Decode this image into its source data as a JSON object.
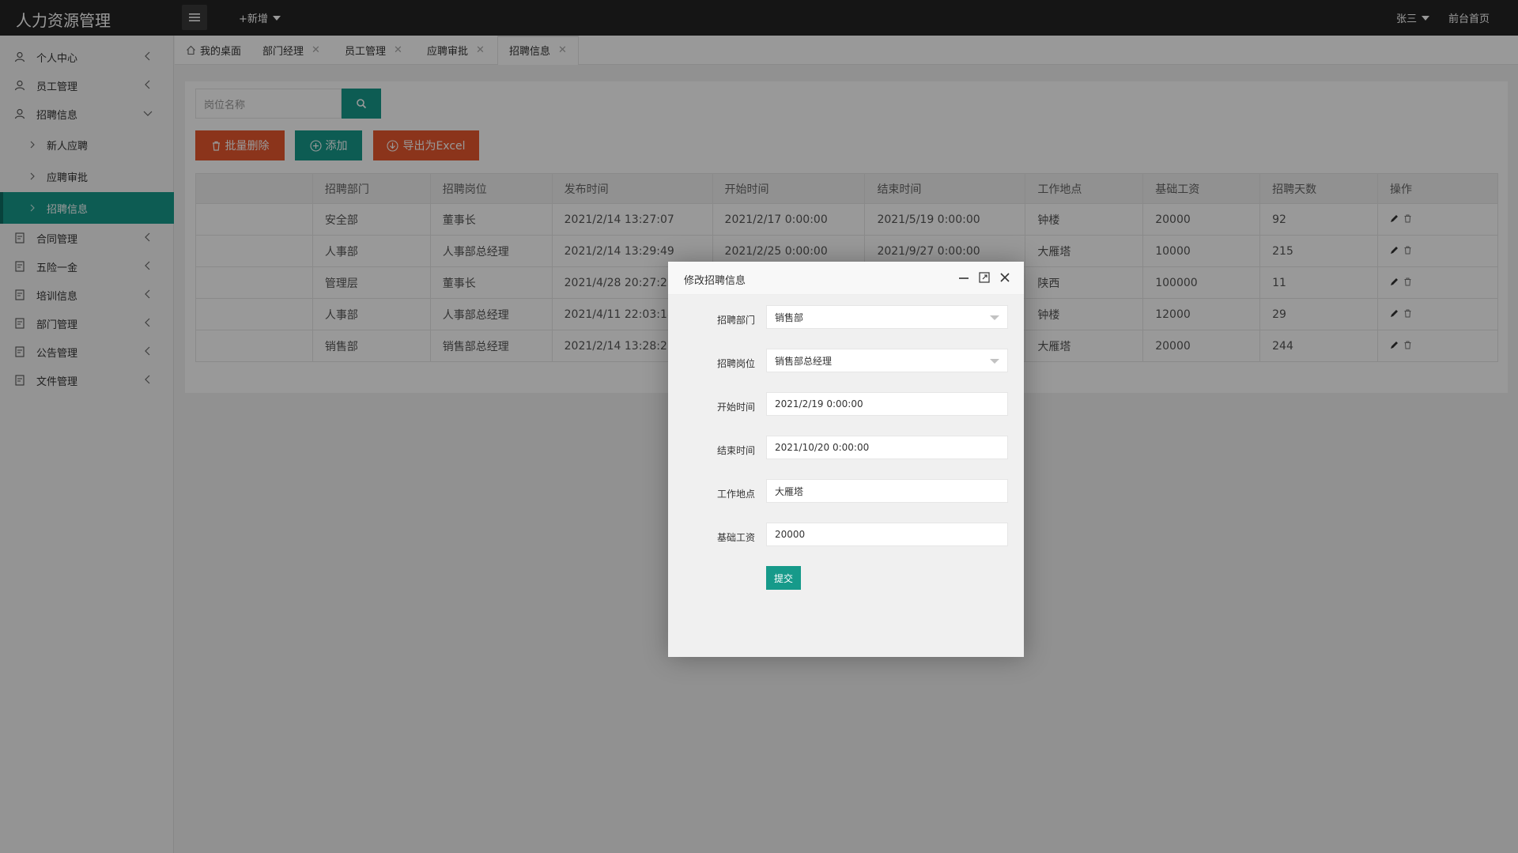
{
  "app": {
    "title": "人力资源管理",
    "new_label": "+新增",
    "user_name": "张三",
    "front_link": "前台首页"
  },
  "sidebar": {
    "items": [
      {
        "label": "个人中心"
      },
      {
        "label": "员工管理"
      },
      {
        "label": "招聘信息",
        "expanded": true
      },
      {
        "label": "合同管理"
      },
      {
        "label": "五险一金"
      },
      {
        "label": "培训信息"
      },
      {
        "label": "部门管理"
      },
      {
        "label": "公告管理"
      },
      {
        "label": "文件管理"
      }
    ],
    "subitems": [
      {
        "label": "新人应聘"
      },
      {
        "label": "应聘审批"
      },
      {
        "label": "招聘信息",
        "active": true
      }
    ]
  },
  "tabs": [
    {
      "label": "我的桌面"
    },
    {
      "label": "部门经理"
    },
    {
      "label": "员工管理"
    },
    {
      "label": "应聘审批"
    },
    {
      "label": "招聘信息",
      "active": true
    }
  ],
  "search": {
    "placeholder": "岗位名称"
  },
  "toolbar": {
    "batch_delete": "批量删除",
    "add": "添加",
    "export": "导出为Excel"
  },
  "table": {
    "headers": [
      "",
      "招聘部门",
      "招聘岗位",
      "发布时间",
      "开始时间",
      "结束时间",
      "工作地点",
      "基础工资",
      "招聘天数",
      "操作"
    ],
    "rows": [
      [
        "",
        "安全部",
        "董事长",
        "2021/2/14 13:27:07",
        "2021/2/17 0:00:00",
        "2021/5/19 0:00:00",
        "钟楼",
        "20000",
        "92"
      ],
      [
        "",
        "人事部",
        "人事部总经理",
        "2021/2/14 13:29:49",
        "2021/2/25 0:00:00",
        "2021/9/27 0:00:00",
        "大雁塔",
        "10000",
        "215"
      ],
      [
        "",
        "管理层",
        "董事长",
        "2021/4/28 20:27:25",
        "",
        "",
        "陕西",
        "100000",
        "11"
      ],
      [
        "",
        "人事部",
        "人事部总经理",
        "2021/4/11 22:03:18",
        "",
        "",
        "钟楼",
        "12000",
        "29"
      ],
      [
        "",
        "销售部",
        "销售部总经理",
        "2021/2/14 13:28:21",
        "",
        "",
        "大雁塔",
        "20000",
        "244"
      ]
    ]
  },
  "modal": {
    "title": "修改招聘信息",
    "fields": [
      {
        "label": "招聘部门",
        "value": "销售部",
        "type": "select"
      },
      {
        "label": "招聘岗位",
        "value": "销售部总经理",
        "type": "select"
      },
      {
        "label": "开始时间",
        "value": "2021/2/19 0:00:00",
        "type": "text"
      },
      {
        "label": "结束时间",
        "value": "2021/10/20 0:00:00",
        "type": "text"
      },
      {
        "label": "工作地点",
        "value": "大雁塔",
        "type": "text"
      },
      {
        "label": "基础工资",
        "value": "20000",
        "type": "text"
      }
    ],
    "submit_label": "提交"
  },
  "colors": {
    "accent": "#169a8a",
    "danger": "#e8582e",
    "topbar": "#232323"
  }
}
